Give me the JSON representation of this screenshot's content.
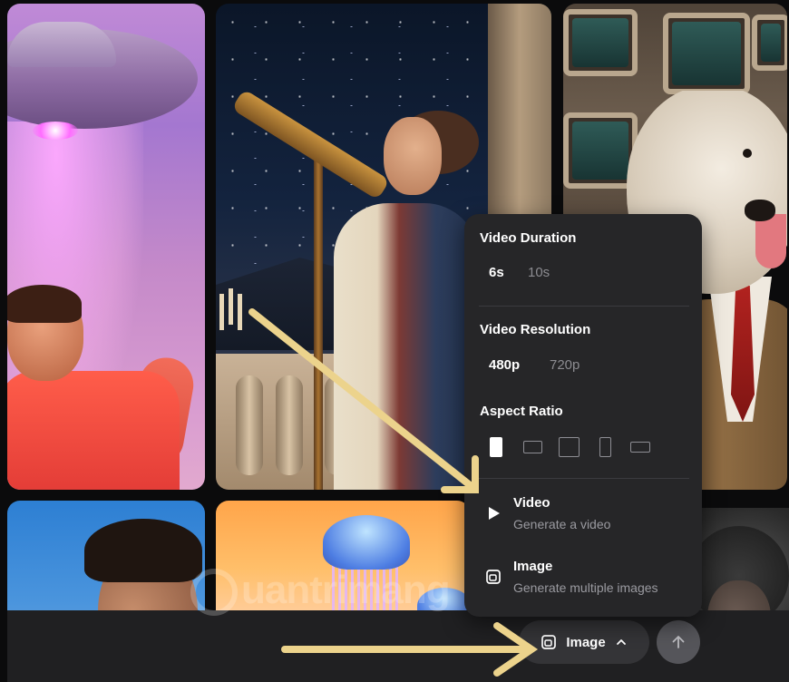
{
  "popover": {
    "duration": {
      "title": "Video Duration",
      "options": [
        "6s",
        "10s"
      ],
      "selected": "6s"
    },
    "resolution": {
      "title": "Video Resolution",
      "options": [
        "480p",
        "720p"
      ],
      "selected": "480p"
    },
    "aspect": {
      "title": "Aspect Ratio",
      "options": [
        "9:16",
        "3:2",
        "1:1",
        "2:3",
        "16:9"
      ],
      "selected": "9:16"
    },
    "modes": [
      {
        "title": "Video",
        "subtitle": "Generate a video",
        "icon": "play-icon"
      },
      {
        "title": "Image",
        "subtitle": "Generate multiple images",
        "icon": "image-mode-icon"
      }
    ]
  },
  "bottom_bar": {
    "mode_button_label": "Image",
    "mode_button_icon": "image-mode-icon",
    "chevron_icon": "chevron-up-icon",
    "submit_icon": "arrow-up-icon"
  },
  "watermark": "uantrimang",
  "colors": {
    "arrow": "#ecd38c",
    "popover_bg": "#262628",
    "bar_bg": "#202022"
  }
}
